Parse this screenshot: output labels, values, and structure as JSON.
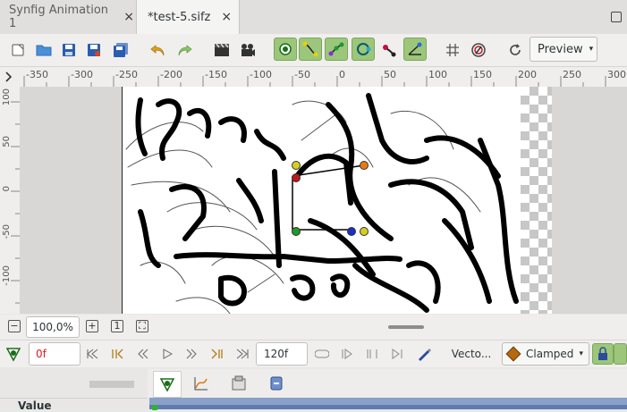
{
  "tabs": [
    {
      "label": "Synfig Animation 1",
      "close": "×"
    },
    {
      "label": "*test-5.sifz",
      "close": "×"
    }
  ],
  "toolbar": {
    "render_mode": "Preview",
    "render_mode_arrow": "▾",
    "icons": [
      "new-file-icon",
      "open-file-icon",
      "save-icon",
      "save-as-icon",
      "save-all-icon",
      "undo-icon",
      "redo-icon",
      "render-icon",
      "preview-icon",
      "toggle-position-handles-icon",
      "toggle-tangent-handles-icon",
      "toggle-width-handles-icon",
      "toggle-radius-handles-icon",
      "toggle-bone-handles-icon",
      "toggle-angle-handles-icon",
      "grid-icon",
      "onion-skin-icon",
      "refresh-icon"
    ]
  },
  "rulers": {
    "horizontal": [
      "-350",
      "-300",
      "-250",
      "-200",
      "-150",
      "-100",
      "-50",
      "0",
      "50",
      "100",
      "150",
      "200",
      "250",
      "300"
    ],
    "vertical": [
      "100",
      "50",
      "0",
      "-50",
      "-100"
    ]
  },
  "zoom": {
    "minus": "−",
    "value": "100,0%",
    "plus": "+",
    "fit": "1",
    "fit_all": "⛶"
  },
  "timebar": {
    "current_time": "0f",
    "end_time": "120f",
    "vector_mode": "Vecto...",
    "interpolation": "Clamped",
    "interpolation_arrow": "▾"
  },
  "panel": {
    "value_label": "Value"
  },
  "colors": {
    "toggle_active": "#9cc67a",
    "time_text": "#e01b1b",
    "interpolation_diamond": "#b36a12",
    "timeline_bar": "#8aa0c8"
  }
}
